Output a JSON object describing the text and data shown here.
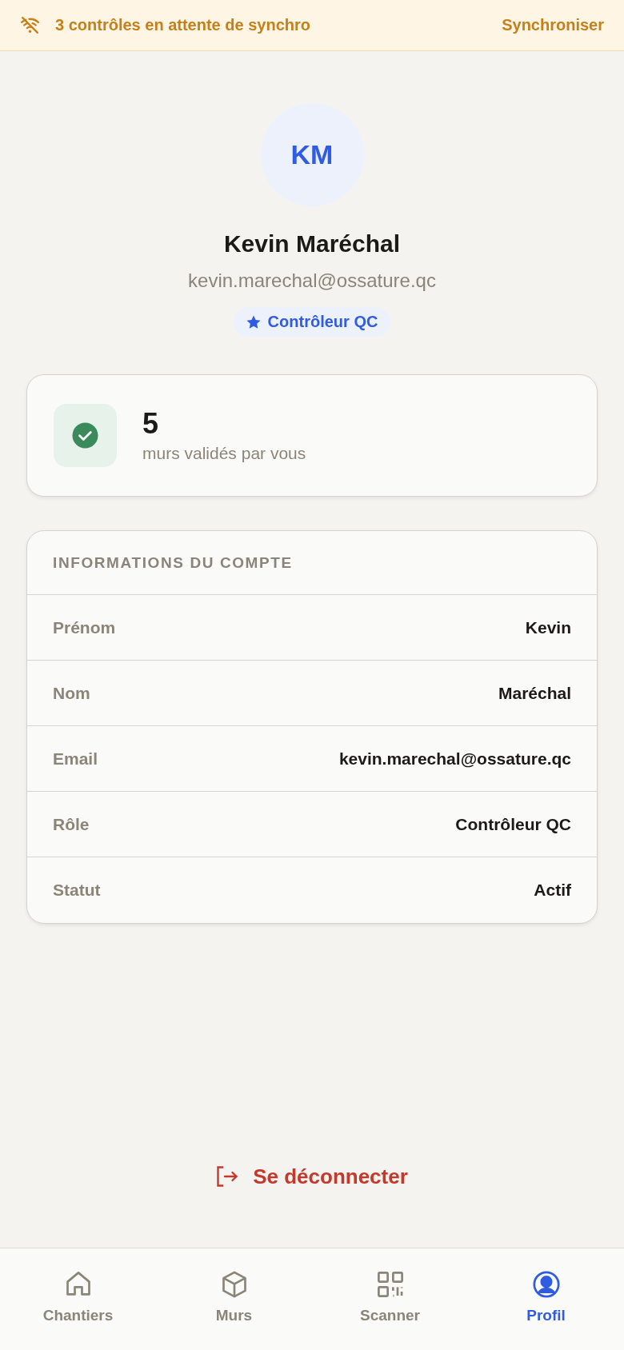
{
  "sync_banner": {
    "message": "3 contrôles en attente de synchro",
    "action": "Synchroniser"
  },
  "profile": {
    "initials": "KM",
    "name": "Kevin Maréchal",
    "email": "kevin.marechal@ossature.qc",
    "role_badge": "Contrôleur QC"
  },
  "stat_card": {
    "value": "5",
    "label": "murs validés par vous"
  },
  "account_info": {
    "title": "INFORMATIONS DU COMPTE",
    "rows": [
      {
        "label": "Prénom",
        "value": "Kevin"
      },
      {
        "label": "Nom",
        "value": "Maréchal"
      },
      {
        "label": "Email",
        "value": "kevin.marechal@ossature.qc"
      },
      {
        "label": "Rôle",
        "value": "Contrôleur QC"
      },
      {
        "label": "Statut",
        "value": "Actif"
      }
    ]
  },
  "logout_button": {
    "label": "Se déconnecter"
  },
  "bottom_nav": {
    "tabs": [
      {
        "label": "Chantiers",
        "selected": false
      },
      {
        "label": "Murs",
        "selected": false
      },
      {
        "label": "Scanner",
        "selected": false
      },
      {
        "label": "Profil",
        "selected": true
      }
    ]
  }
}
